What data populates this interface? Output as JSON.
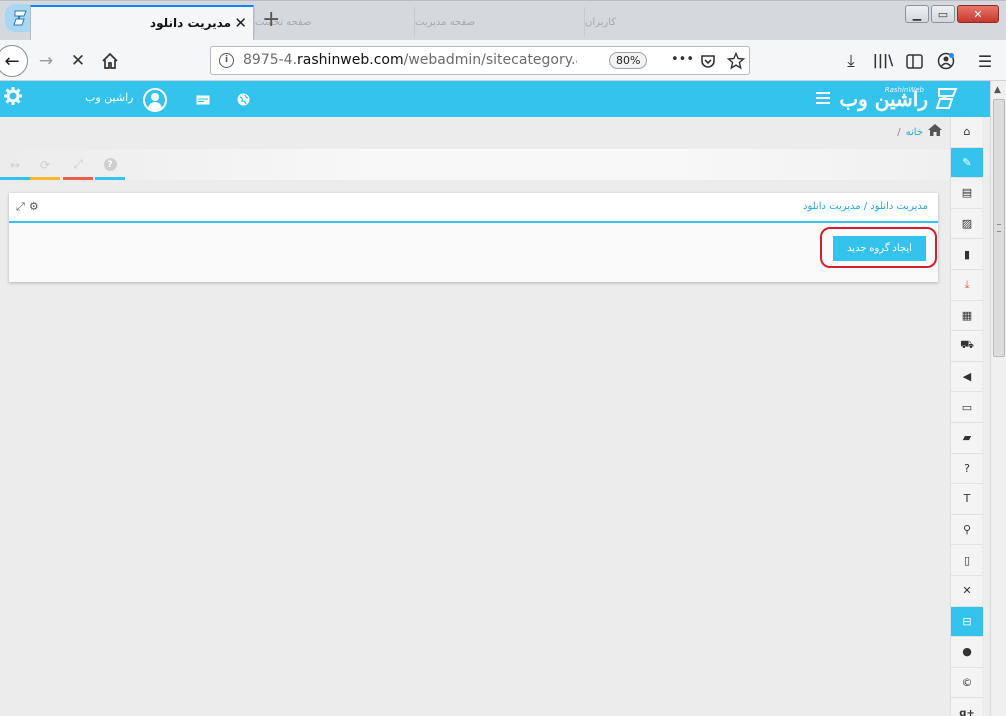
{
  "browser": {
    "tab_title": "مدیریت دانلود",
    "tab_close": "✕",
    "new_tab": "+",
    "background_tabs": [
      "صفحه نخست",
      "صفحه مدیریت",
      "کاربران"
    ],
    "url_prefix": "8975-4.",
    "url_domain": "rashinweb.com",
    "url_path": "/webadmin/sitecategory.aspx?n",
    "zoom": "80%",
    "url_actions": "•••",
    "window_buttons": [
      "▁",
      "▭",
      "✕"
    ]
  },
  "header": {
    "brand": "راشین وب",
    "brand_sub": "RashinWeb",
    "user_name": "راشین وب"
  },
  "breadcrumb": {
    "home": "خانه",
    "separator": "/"
  },
  "settings_bar": {
    "buttons": [
      {
        "icon": "arrows-horizontal-icon",
        "glyph": "↔",
        "color": "#34c3ec"
      },
      {
        "icon": "refresh-icon",
        "glyph": "⟳",
        "color": "#f7b731"
      },
      {
        "icon": "fullscreen-icon",
        "glyph": "⤢",
        "color": "#e95d49"
      },
      {
        "icon": "help-icon",
        "glyph": "?",
        "color": "#34c3ec"
      }
    ]
  },
  "widget": {
    "title": "مدیریت دانلود / مدیریت دانلود",
    "create_button": "ایجاد گروه جدید"
  },
  "sidebar": {
    "items": [
      {
        "icon": "home-icon",
        "glyph": "⌂"
      },
      {
        "icon": "pencil-icon",
        "glyph": "✎",
        "active": true
      },
      {
        "icon": "news-icon",
        "glyph": "▤"
      },
      {
        "icon": "image-icon",
        "glyph": "▨"
      },
      {
        "icon": "document-icon",
        "glyph": "▮"
      },
      {
        "icon": "download-icon",
        "glyph": "⤓"
      },
      {
        "icon": "film-icon",
        "glyph": "▦"
      },
      {
        "icon": "cart-icon",
        "glyph": "⛟"
      },
      {
        "icon": "volume-icon",
        "glyph": "◀"
      },
      {
        "icon": "monitor-icon",
        "glyph": "▭"
      },
      {
        "icon": "book-icon",
        "glyph": "▰"
      },
      {
        "icon": "question-icon",
        "glyph": "?"
      },
      {
        "icon": "text-size-icon",
        "glyph": "T"
      },
      {
        "icon": "pin-icon",
        "glyph": "⚲"
      },
      {
        "icon": "file-icon",
        "glyph": "▯"
      },
      {
        "icon": "excel-icon",
        "glyph": "✕"
      },
      {
        "icon": "inbox-icon",
        "glyph": "⊟",
        "active": true
      },
      {
        "icon": "user-icon",
        "glyph": "●"
      },
      {
        "icon": "copyright-icon",
        "glyph": "©"
      },
      {
        "icon": "google-plus-icon",
        "glyph": "g+"
      }
    ]
  },
  "colors": {
    "accent": "#34c3ec",
    "highlight": "#d61d2b"
  }
}
